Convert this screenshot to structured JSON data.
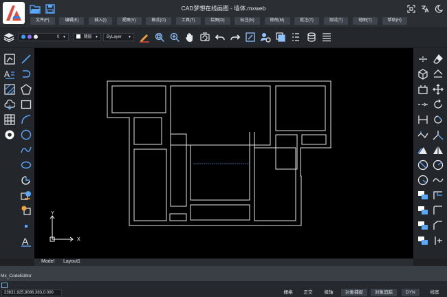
{
  "app": {
    "title": "CAD梦想在线画图 - 墙体.mxweb"
  },
  "menubar": [
    "文件(F)",
    "编辑(E)",
    "插入(I)",
    "视图(V)",
    "格式(O)",
    "工具(T)",
    "绘图(D)",
    "标注(N)",
    "修改(M)",
    "批注(T)",
    "测试(T)",
    "地图(T)",
    "帮助(H)"
  ],
  "toolbar": {
    "layer_value": "0",
    "color_value": "随层",
    "linetype_value": "ByLayer"
  },
  "canvas": {
    "axis_x_label": "X",
    "axis_y_label": "Y"
  },
  "tabs": [
    "Model",
    "Layout1"
  ],
  "editor": {
    "label": "Mx_CodeEditor"
  },
  "status": {
    "coordinates": "23631.925,9086.383,0.000",
    "buttons": [
      "栅格",
      "正交",
      "极轴",
      "对象捕捉",
      "对象追踪",
      "DYN",
      "线宽"
    ]
  },
  "colors": {
    "accent": "#e64a3c",
    "canvas_bg": "#000000",
    "highlight": "#39a0ff"
  },
  "icons": {
    "quick_access": [
      "open-folder-icon",
      "save-icon"
    ],
    "window": [
      "fullscreen-icon",
      "translate-icon",
      "theme-toggle-icon"
    ],
    "left_tools": [
      "line-icon",
      "polyline-icon",
      "text-icon",
      "arc-icon",
      "hatch-icon",
      "polygon-icon",
      "cloud-icon",
      "rectangle-icon",
      "table-icon",
      "spline-arc-icon",
      "donut-icon",
      "circle-icon",
      "spline-icon",
      "ellipse-icon",
      "ellipse-arc-icon",
      "insert-block-icon",
      "make-block-icon",
      "point-icon",
      "mtext-icon"
    ],
    "right_tools": [
      "erase-icon",
      "copy-icon",
      "mirror-icon",
      "offset-icon",
      "array-icon",
      "move-icon",
      "rotate-icon",
      "scale-icon",
      "stretch-icon",
      "trim-icon",
      "extend-icon",
      "break-icon",
      "join-icon",
      "chamfer-icon",
      "fillet-icon",
      "explode-icon"
    ]
  }
}
